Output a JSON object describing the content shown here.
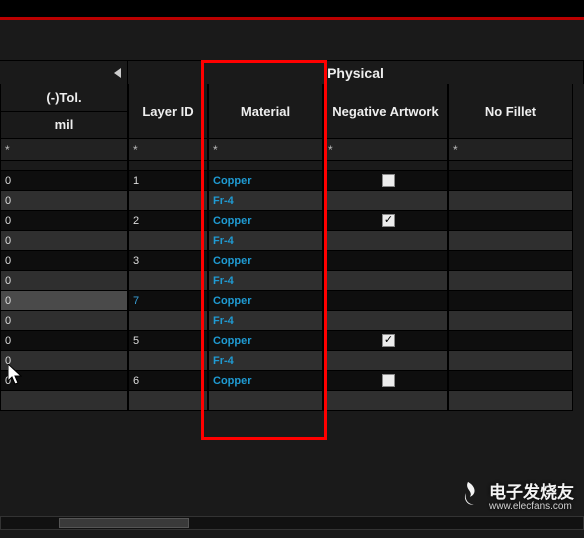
{
  "group_header": "Physical",
  "columns": {
    "tol": "(-)Tol.",
    "tol_unit": "mil",
    "layer_id": "Layer ID",
    "material": "Material",
    "neg_art": "Negative Artwork",
    "no_fillet": "No Fillet"
  },
  "filter_glyph": "*",
  "rows": [
    {
      "tol": "0",
      "lid": "1",
      "mat": "Copper",
      "neg": "box",
      "shade": "dark"
    },
    {
      "tol": "0",
      "lid": "",
      "mat": "Fr-4",
      "neg": "",
      "shade": "light"
    },
    {
      "tol": "0",
      "lid": "2",
      "mat": "Copper",
      "neg": "check",
      "shade": "dark"
    },
    {
      "tol": "0",
      "lid": "",
      "mat": "Fr-4",
      "neg": "",
      "shade": "light"
    },
    {
      "tol": "0",
      "lid": "3",
      "mat": "Copper",
      "neg": "",
      "shade": "dark"
    },
    {
      "tol": "0",
      "lid": "",
      "mat": "Fr-4",
      "neg": "",
      "shade": "light"
    },
    {
      "tol": "0",
      "lid": "7",
      "mat": "Copper",
      "neg": "",
      "shade": "dark",
      "selected": true
    },
    {
      "tol": "0",
      "lid": "",
      "mat": "Fr-4",
      "neg": "",
      "shade": "light"
    },
    {
      "tol": "0",
      "lid": "5",
      "mat": "Copper",
      "neg": "check",
      "shade": "dark"
    },
    {
      "tol": "0",
      "lid": "",
      "mat": "Fr-4",
      "neg": "",
      "shade": "light"
    },
    {
      "tol": "0",
      "lid": "6",
      "mat": "Copper",
      "neg": "box",
      "shade": "dark"
    },
    {
      "tol": "",
      "lid": "",
      "mat": "",
      "neg": "",
      "shade": "light"
    }
  ],
  "watermark": {
    "brand": "电子发烧友",
    "url": "www.elecfans.com"
  }
}
